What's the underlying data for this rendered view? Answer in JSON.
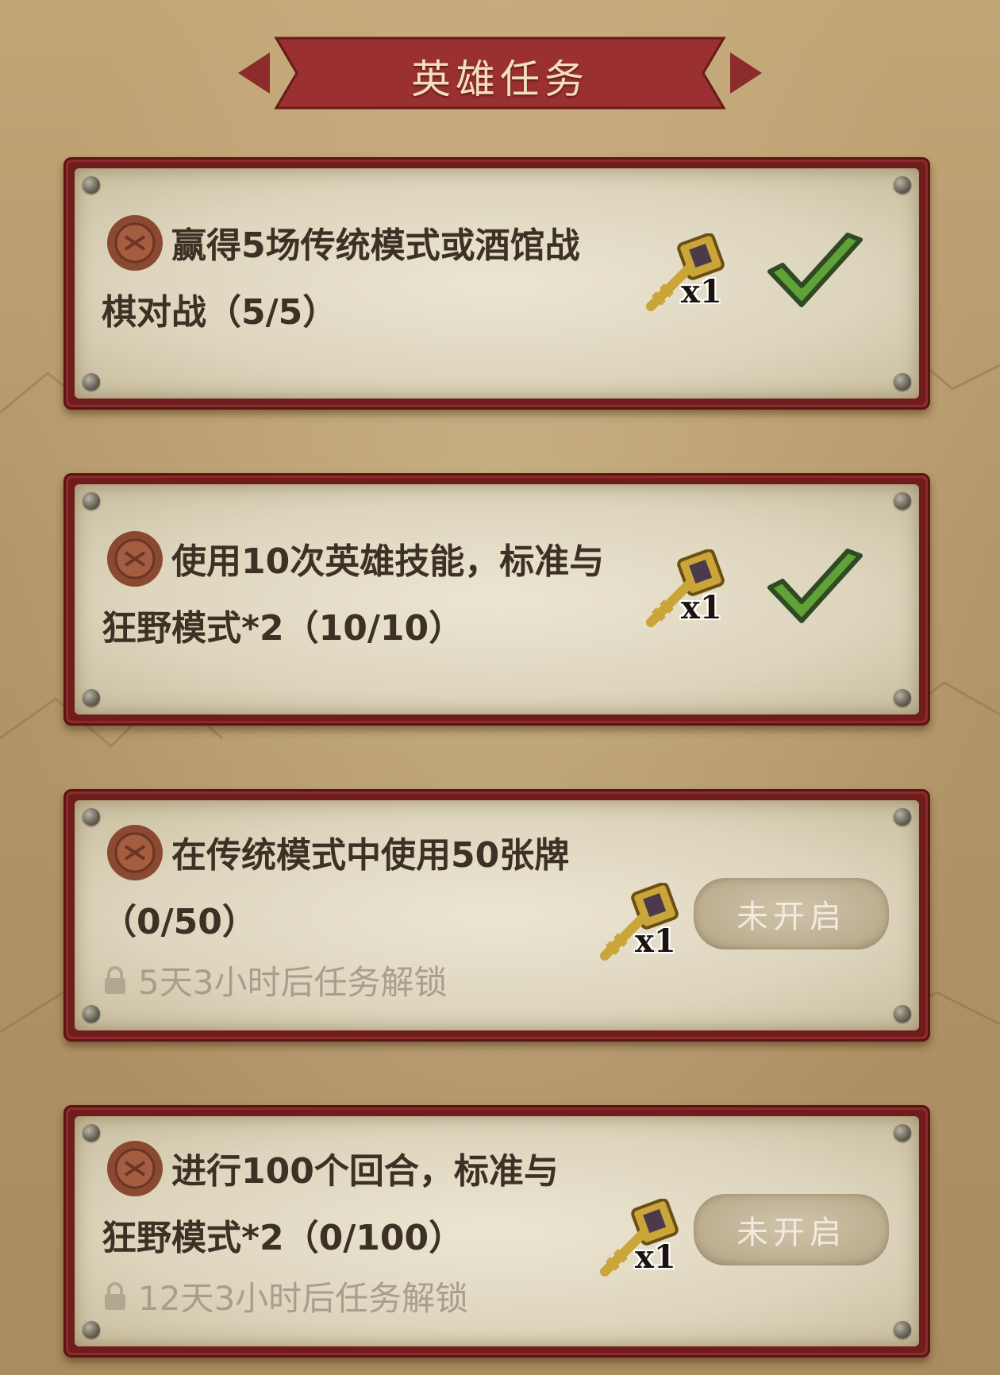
{
  "header": {
    "title": "英雄任务"
  },
  "quests": [
    {
      "text": "赢得5场传统模式或酒馆战棋对战（5/5）",
      "reward_count": "x1",
      "status": "completed",
      "status_icon": "green-checkmark-icon"
    },
    {
      "text": "使用10次英雄技能，标准与狂野模式*2（10/10）",
      "reward_count": "x1",
      "status": "completed",
      "status_icon": "green-checkmark-icon"
    },
    {
      "text": "在传统模式中使用50张牌（0/50）",
      "reward_count": "x1",
      "status": "locked",
      "button_label": "未开启",
      "unlock_text": "5天3小时后任务解锁"
    },
    {
      "text": "进行100个回合，标准与狂野模式*2（0/100）",
      "reward_count": "x1",
      "status": "locked",
      "button_label": "未开启",
      "unlock_text": "12天3小时后任务解锁"
    }
  ],
  "colors": {
    "frame_red": "#8e2a2a",
    "parchment": "#ddd5bd",
    "check_green": "#5fa238",
    "text_dark": "#3b3124",
    "text_muted": "#a79e8c"
  }
}
